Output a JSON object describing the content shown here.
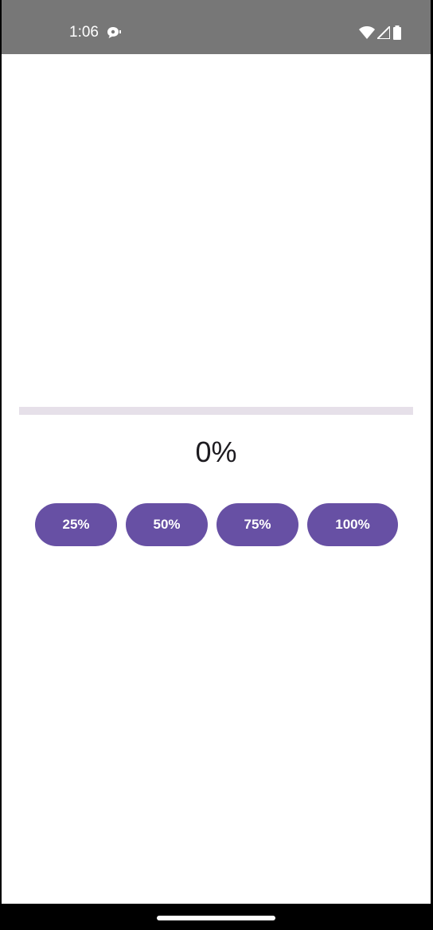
{
  "status_bar": {
    "time": "1:06",
    "icons": [
      "notification-icon",
      "wifi-icon",
      "signal-icon",
      "battery-icon"
    ]
  },
  "progress": {
    "value_fraction": 0,
    "label": "0%"
  },
  "buttons": [
    {
      "label": "25%"
    },
    {
      "label": "50%"
    },
    {
      "label": "75%"
    },
    {
      "label": "100%"
    }
  ],
  "colors": {
    "primary": "#6750a4",
    "track": "#e6e0e9",
    "status_bar": "#777777",
    "text": "#1d1b20"
  }
}
